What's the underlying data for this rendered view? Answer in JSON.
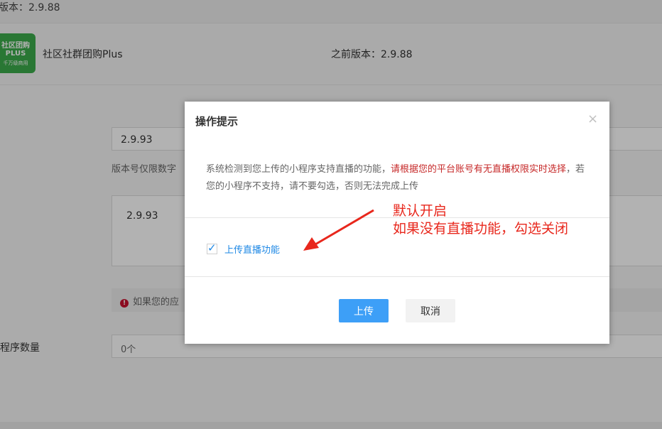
{
  "background": {
    "top_row": {
      "version_text": "版本：2.9.88"
    },
    "app": {
      "logo": {
        "line1": "社区团购",
        "line2": "PLUS",
        "line3": "千万级商用"
      },
      "name": "社区社群团购Plus",
      "previous_version": "之前版本：2.9.88"
    },
    "version_input_value": "2.9.93",
    "version_hint": "版本号仅限数字",
    "description_value": "2.9.93",
    "warning_text": "如果您的应",
    "count_label": "程序数量",
    "count_value": "0个"
  },
  "dialog": {
    "title": "操作提示",
    "close_symbol": "×",
    "message_part1": "系统检测到您上传的小程序支持直播的功能，",
    "message_red": "请根据您的平台账号有无直播权限实时选择",
    "message_part2": "，若您的小程序不支持，请不要勾选，否则无法完成上传",
    "checkbox_label": "上传直播功能",
    "checkbox_checked": true,
    "upload_label": "上传",
    "cancel_label": "取消"
  },
  "annotation": {
    "line1": "默认开启",
    "line2": "如果没有直播功能，勾选关闭"
  },
  "colors": {
    "primary_button": "#3d9ff7",
    "checkbox_accent": "#1e88e5",
    "warning_text_red": "#c62828",
    "annotation_red": "#e8271c",
    "logo_green": "#3cab4b"
  }
}
